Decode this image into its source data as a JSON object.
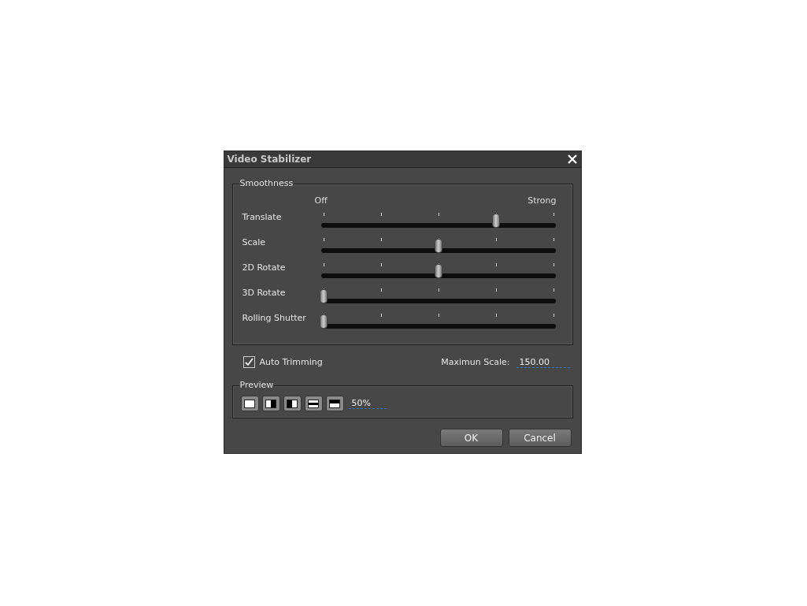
{
  "dialog": {
    "title": "Video Stabilizer",
    "smoothness": {
      "legend": "Smoothness",
      "min_label": "Off",
      "max_label": "Strong",
      "sliders": [
        {
          "label": "Translate",
          "level": 0.75
        },
        {
          "label": "Scale",
          "level": 0.5
        },
        {
          "label": "2D Rotate",
          "level": 0.5
        },
        {
          "label": "3D Rotate",
          "level": 0
        },
        {
          "label": "Rolling Shutter",
          "level": 0
        }
      ]
    },
    "auto_trimming": {
      "label": "Auto Trimming",
      "checked": true
    },
    "maximum_scale": {
      "label": "Maximun Scale:",
      "value": "150.00"
    },
    "preview": {
      "legend": "Preview",
      "modes": [
        {
          "kind": "full"
        },
        {
          "kind": "left"
        },
        {
          "kind": "right"
        },
        {
          "kind": "middle"
        },
        {
          "kind": "top"
        }
      ],
      "value": "50%"
    },
    "buttons": [
      "OK",
      "Cancel"
    ]
  }
}
